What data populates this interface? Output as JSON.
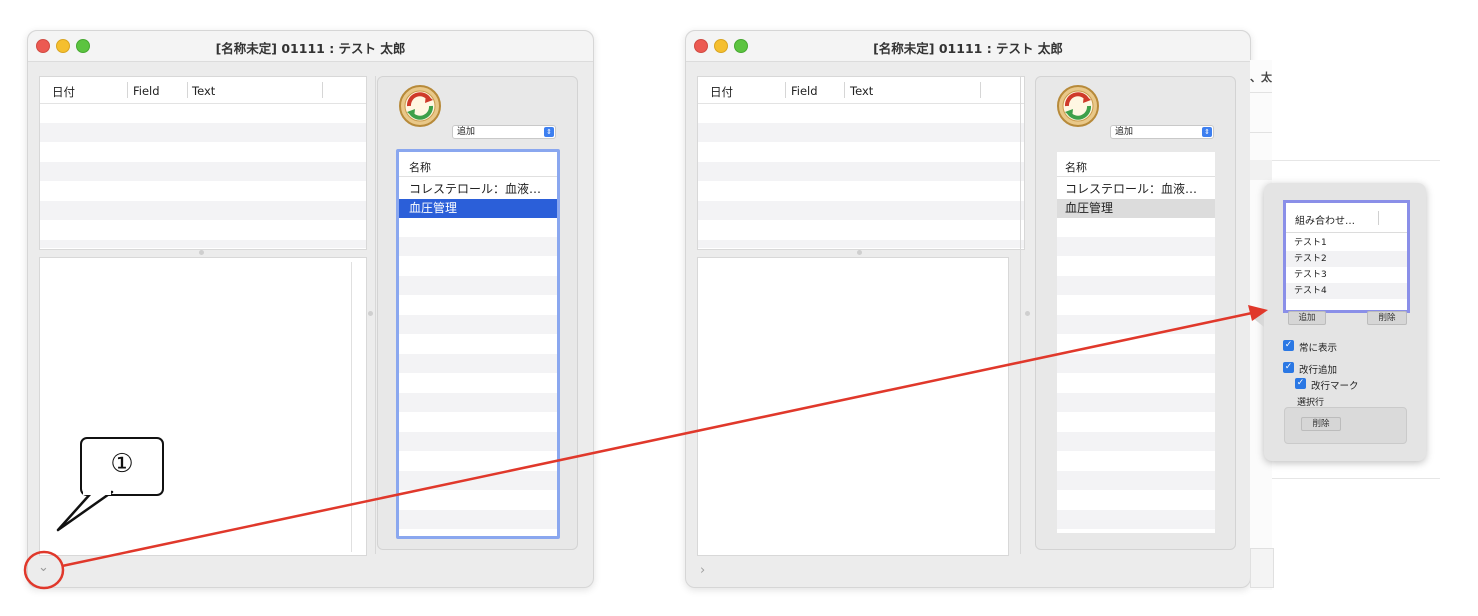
{
  "left_window": {
    "title": "[名称未定] 01111 : テスト 太郎",
    "columns": [
      "日付",
      "Field",
      "Text"
    ],
    "popup_value": "追加",
    "list_header": "名称",
    "list_items": [
      "コレステロール：血液…",
      "血圧管理"
    ],
    "selected_index": 1,
    "disclosure_glyph": "⌄"
  },
  "right_window": {
    "title": "[名称未定] 01111 : テスト 太郎",
    "columns": [
      "日付",
      "Field",
      "Text"
    ],
    "popup_value": "追加",
    "list_header": "名称",
    "list_items": [
      "コレステロール：血液…",
      "血圧管理"
    ],
    "disclosure_glyph": "›",
    "behind_fragment": "、太"
  },
  "callout": {
    "label": "①"
  },
  "popover": {
    "table_header": "組み合わせ…",
    "rows": [
      "テスト1",
      "テスト2",
      "テスト3",
      "テスト4"
    ],
    "add_button": "追加",
    "delete_button": "削除",
    "always_show": "常に表示",
    "newline_add": "改行追加",
    "newline_mark": "改行マーク",
    "selected_row_label": "選択行",
    "row_delete_button": "削除"
  },
  "colors": {
    "accent": "#2b5fd9",
    "annotation": "#e0382b",
    "focus_ring": "#8aa7ef"
  },
  "icons": [
    "sync-icon",
    "chevron-down-icon",
    "chevron-right-icon"
  ]
}
